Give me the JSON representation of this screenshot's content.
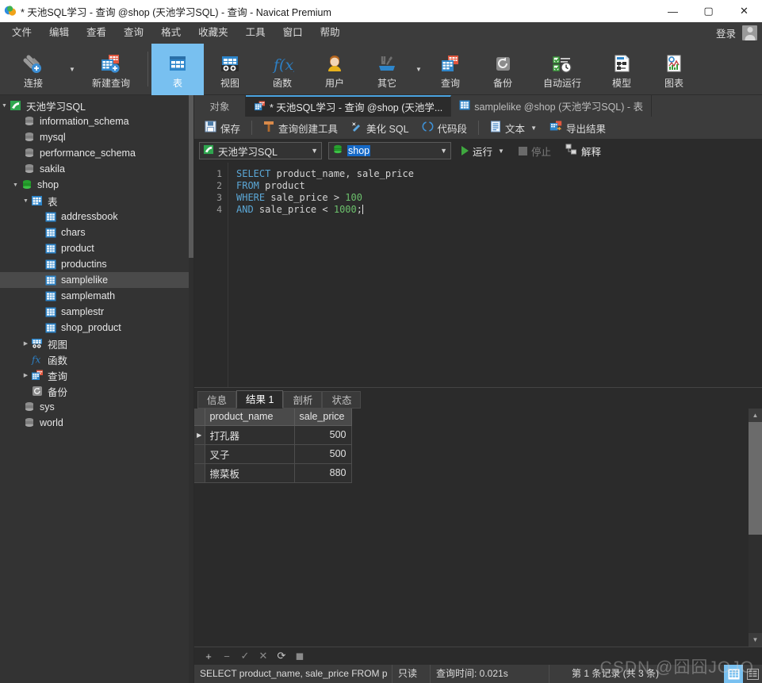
{
  "window": {
    "title": "* 天池SQL学习 - 查询 @shop (天池学习SQL) - 查询 - Navicat Premium",
    "minimize": "—",
    "maximize": "▢",
    "close": "✕"
  },
  "menubar": {
    "items": [
      "文件",
      "编辑",
      "查看",
      "查询",
      "格式",
      "收藏夹",
      "工具",
      "窗口",
      "帮助"
    ],
    "login_label": "登录"
  },
  "toolbar": {
    "items": [
      {
        "label": "连接",
        "icon": "connection-icon",
        "caret": true
      },
      {
        "label": "新建查询",
        "icon": "new-query-icon",
        "caret": false
      },
      {
        "label": "表",
        "icon": "table-icon",
        "active": true
      },
      {
        "label": "视图",
        "icon": "view-icon"
      },
      {
        "label": "函数",
        "icon": "function-icon"
      },
      {
        "label": "用户",
        "icon": "user-icon"
      },
      {
        "label": "其它",
        "icon": "other-tools-icon",
        "caret": true
      },
      {
        "label": "查询",
        "icon": "query-icon"
      },
      {
        "label": "备份",
        "icon": "backup-icon"
      },
      {
        "label": "自动运行",
        "icon": "automation-icon"
      },
      {
        "label": "模型",
        "icon": "model-icon"
      },
      {
        "label": "图表",
        "icon": "chart-icon"
      }
    ]
  },
  "sidebar": {
    "nodes": [
      {
        "label": "天池学习SQL",
        "indent": 0,
        "arrow": "down",
        "icon": "connection-green-icon"
      },
      {
        "label": "information_schema",
        "indent": 1,
        "arrow": "none",
        "icon": "database-gray-icon"
      },
      {
        "label": "mysql",
        "indent": 1,
        "arrow": "none",
        "icon": "database-gray-icon"
      },
      {
        "label": "performance_schema",
        "indent": 1,
        "arrow": "none",
        "icon": "database-gray-icon"
      },
      {
        "label": "sakila",
        "indent": 1,
        "arrow": "none",
        "icon": "database-gray-icon"
      },
      {
        "label": "shop",
        "indent": 1,
        "arrow": "down",
        "icon": "database-green-icon"
      },
      {
        "label": "表",
        "indent": 2,
        "arrow": "down",
        "icon": "table-folder-icon"
      },
      {
        "label": "addressbook",
        "indent": 3,
        "arrow": "none",
        "icon": "table-icon"
      },
      {
        "label": "chars",
        "indent": 3,
        "arrow": "none",
        "icon": "table-icon"
      },
      {
        "label": "product",
        "indent": 3,
        "arrow": "none",
        "icon": "table-icon"
      },
      {
        "label": "productins",
        "indent": 3,
        "arrow": "none",
        "icon": "table-icon"
      },
      {
        "label": "samplelike",
        "indent": 3,
        "arrow": "none",
        "icon": "table-icon",
        "selected": true
      },
      {
        "label": "samplemath",
        "indent": 3,
        "arrow": "none",
        "icon": "table-icon"
      },
      {
        "label": "samplestr",
        "indent": 3,
        "arrow": "none",
        "icon": "table-icon"
      },
      {
        "label": "shop_product",
        "indent": 3,
        "arrow": "none",
        "icon": "table-icon"
      },
      {
        "label": "视图",
        "indent": 2,
        "arrow": "right",
        "icon": "view-folder-icon"
      },
      {
        "label": "函数",
        "indent": 2,
        "arrow": "none",
        "icon": "function-folder-icon"
      },
      {
        "label": "查询",
        "indent": 2,
        "arrow": "right",
        "icon": "query-folder-icon"
      },
      {
        "label": "备份",
        "indent": 2,
        "arrow": "none",
        "icon": "backup-folder-icon"
      },
      {
        "label": "sys",
        "indent": 1,
        "arrow": "none",
        "icon": "database-gray-icon"
      },
      {
        "label": "world",
        "indent": 1,
        "arrow": "none",
        "icon": "database-gray-icon"
      }
    ]
  },
  "tabstrip": {
    "object_button": "对象",
    "tabs": [
      {
        "label": "* 天池SQL学习 - 查询 @shop (天池学...",
        "icon": "query-icon",
        "active": true
      },
      {
        "label": "samplelike @shop (天池学习SQL) - 表",
        "icon": "table-icon",
        "active": false
      }
    ]
  },
  "query_toolbar": {
    "save": "保存",
    "query_builder": "查询创建工具",
    "beautify_sql": "美化 SQL",
    "snippet": "代码段",
    "text": "文本",
    "export_result": "导出结果"
  },
  "connection_bar": {
    "connection": "天池学习SQL",
    "database": "shop",
    "run": "运行",
    "stop": "停止",
    "explain": "解释"
  },
  "editor": {
    "line_numbers": [
      "1",
      "2",
      "3",
      "4"
    ],
    "lines": [
      [
        {
          "t": "SELECT",
          "c": "kw"
        },
        {
          "t": " product_name, sale_price",
          "c": "pl"
        }
      ],
      [
        {
          "t": "FROM",
          "c": "kw"
        },
        {
          "t": " product",
          "c": "pl"
        }
      ],
      [
        {
          "t": "WHERE",
          "c": "kw"
        },
        {
          "t": " sale_price > ",
          "c": "pl"
        },
        {
          "t": "100",
          "c": "num"
        }
      ],
      [
        {
          "t": "AND",
          "c": "kw"
        },
        {
          "t": " sale_price < ",
          "c": "pl"
        },
        {
          "t": "1000",
          "c": "num"
        },
        {
          "t": ";",
          "c": "pl"
        }
      ]
    ]
  },
  "results": {
    "tabs": [
      {
        "label": "信息",
        "active": false
      },
      {
        "label": "结果 1",
        "active": true
      },
      {
        "label": "剖析",
        "active": false
      },
      {
        "label": "状态",
        "active": false
      }
    ],
    "columns": [
      "product_name",
      "sale_price"
    ],
    "rows": [
      {
        "marker": "▶",
        "product_name": "打孔器",
        "sale_price": "500"
      },
      {
        "marker": "",
        "product_name": "叉子",
        "sale_price": "500"
      },
      {
        "marker": "",
        "product_name": "擦菜板",
        "sale_price": "880"
      }
    ],
    "actions": [
      "+",
      "−",
      "✓",
      "✕",
      "⟳",
      "◼"
    ]
  },
  "statusbar": {
    "sql": "SELECT product_name, sale_price FROM p",
    "readonly": "只读",
    "query_time": "查询时间: 0.021s",
    "record_info": "第 1 条记录 (共 3 条)"
  },
  "watermark": "CSDN @囧囧JOJO"
}
